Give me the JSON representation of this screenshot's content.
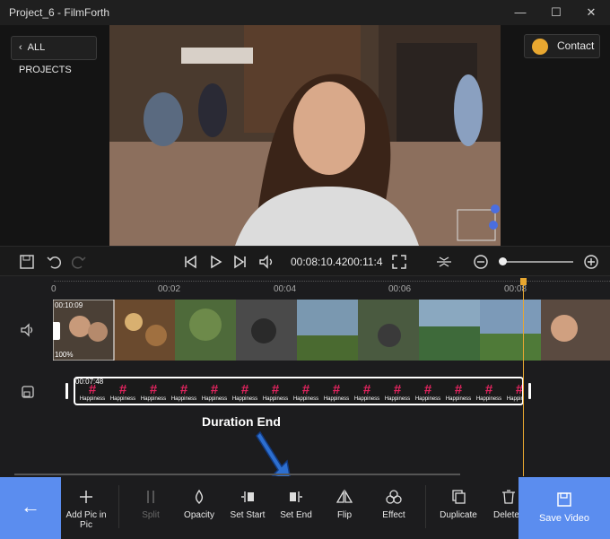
{
  "window": {
    "title": "Project_6 - FilmForth",
    "minimize": "—",
    "maximize": "☐",
    "close": "✕"
  },
  "header": {
    "back_label": "ALL PROJECTS",
    "contact_label": "Contact"
  },
  "player": {
    "timecode": "00:08:10.4200:11:4",
    "zoom_level": 0.05
  },
  "ruler": {
    "ticks": [
      "0",
      "00:02",
      "00:04",
      "00:06",
      "00:08"
    ]
  },
  "video_track": {
    "clip_duration": "00:10:09",
    "clip_volume": "100%",
    "add_label": "+"
  },
  "pip_track": {
    "duration": "00:07:48",
    "item_symbol": "#",
    "item_label": "Happiness",
    "item_count": 15
  },
  "annotation": {
    "text": "Duration End"
  },
  "toolbar": {
    "back_icon": "←",
    "items": [
      {
        "label": "Add Pic in Pic",
        "icon": "plus-icon"
      },
      {
        "label": "Split",
        "icon": "split-icon"
      },
      {
        "label": "Opacity",
        "icon": "drop-icon"
      },
      {
        "label": "Set Start",
        "icon": "set-start-icon"
      },
      {
        "label": "Set End",
        "icon": "set-end-icon"
      },
      {
        "label": "Flip",
        "icon": "flip-icon"
      },
      {
        "label": "Effect",
        "icon": "effect-icon"
      },
      {
        "label": "Duplicate",
        "icon": "duplicate-icon"
      },
      {
        "label": "Delete",
        "icon": "trash-icon"
      }
    ],
    "save_label": "Save Video"
  },
  "colors": {
    "accent": "#5b8def",
    "playhead": "#e8a730",
    "pip_symbol": "#e0245e"
  }
}
